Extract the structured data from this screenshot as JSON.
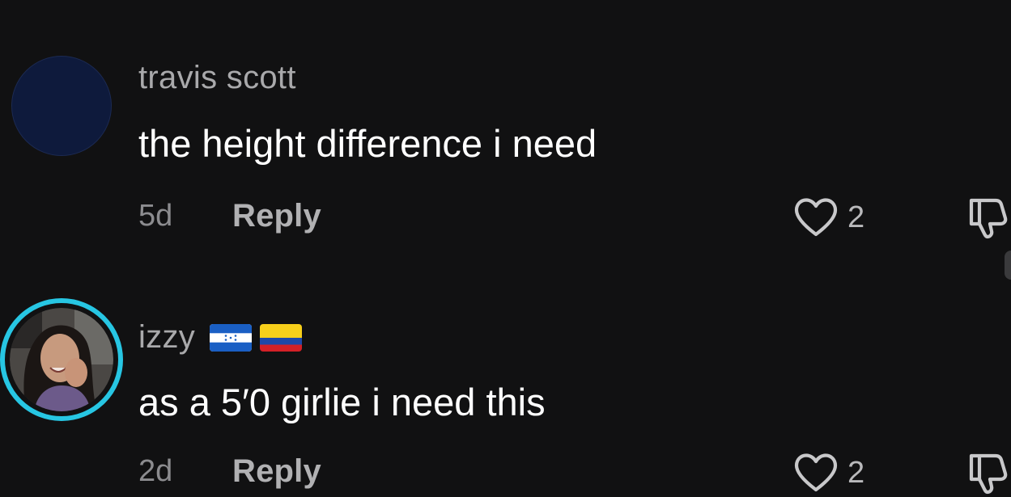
{
  "comments": [
    {
      "username": "travis scott",
      "text": "the height difference i need",
      "time": "5d",
      "reply_label": "Reply",
      "likes": "2",
      "avatar": "blank-navy-avatar"
    },
    {
      "username": "izzy",
      "flags": [
        "honduras-flag",
        "colombia-flag"
      ],
      "text": "as a 5′0 girlie i need this",
      "time": "2d",
      "reply_label": "Reply",
      "likes": "2",
      "avatar": "photo-avatar-with-story-ring"
    }
  ],
  "colors": {
    "background": "#111112",
    "story_ring": "#27c6e3",
    "username": "#a9a9ab",
    "text": "#ffffff",
    "muted": "#8c8c8f"
  },
  "icons": {
    "like": "heart-outline-icon",
    "dislike": "thumbs-down-icon"
  }
}
